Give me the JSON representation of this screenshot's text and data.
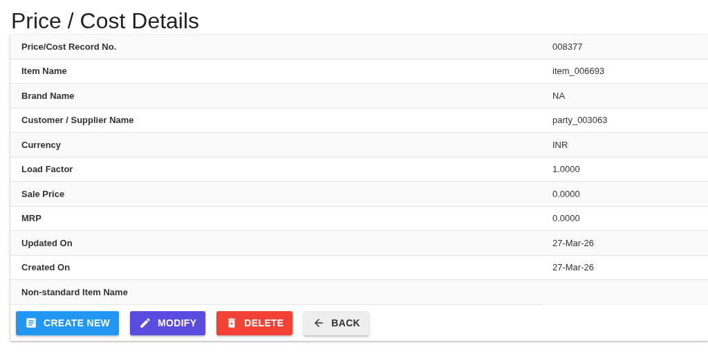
{
  "title": "Price / Cost Details",
  "rows": [
    {
      "label": "Price/Cost Record No.",
      "value": "008377"
    },
    {
      "label": "Item Name",
      "value": "item_006693"
    },
    {
      "label": "Brand Name",
      "value": "NA"
    },
    {
      "label": "Customer / Supplier Name",
      "value": "party_003063"
    },
    {
      "label": "Currency",
      "value": "INR"
    },
    {
      "label": "Load Factor",
      "value": "1.0000"
    },
    {
      "label": "Sale Price",
      "value": "0.0000"
    },
    {
      "label": "MRP",
      "value": "0.0000"
    },
    {
      "label": "Updated On",
      "value": "27-Mar-26"
    },
    {
      "label": "Created On",
      "value": "27-Mar-26"
    },
    {
      "label": "Non-standard Item Name"
    }
  ],
  "buttons": [
    {
      "kind": "create",
      "label": "CREATE NEW"
    },
    {
      "kind": "modify",
      "label": "MODIFY"
    },
    {
      "kind": "delete",
      "label": "DELETE"
    },
    {
      "kind": "back",
      "label": "BACK"
    }
  ]
}
